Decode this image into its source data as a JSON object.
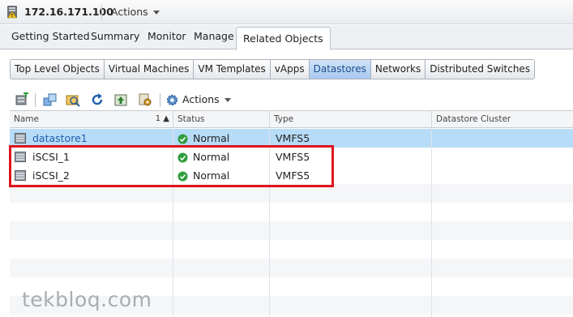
{
  "header": {
    "host": "172.16.171.100",
    "actions_label": "Actions"
  },
  "main_tabs": [
    {
      "label": "Getting Started",
      "active": false
    },
    {
      "label": "Summary",
      "active": false
    },
    {
      "label": "Monitor",
      "active": false
    },
    {
      "label": "Manage",
      "active": false
    },
    {
      "label": "Related Objects",
      "active": true
    }
  ],
  "sub_tabs": [
    {
      "label": "Top Level Objects",
      "active": false
    },
    {
      "label": "Virtual Machines",
      "active": false
    },
    {
      "label": "VM Templates",
      "active": false
    },
    {
      "label": "vApps",
      "active": false
    },
    {
      "label": "Datastores",
      "active": true
    },
    {
      "label": "Networks",
      "active": false
    },
    {
      "label": "Distributed Switches",
      "active": false
    }
  ],
  "toolbar": {
    "icons": [
      "new-datastore-icon",
      "migrate-icon",
      "browse-files-icon",
      "refresh-icon",
      "upload-icon",
      "settings-icon"
    ],
    "actions_label": "Actions"
  },
  "grid": {
    "columns": [
      "Name",
      "Status",
      "Type",
      "Datastore Cluster"
    ],
    "sort_indicator": "1 ▲",
    "rows": [
      {
        "name": "datastore1",
        "status": "Normal",
        "type": "VMFS5",
        "cluster": "",
        "selected": true
      },
      {
        "name": "iSCSI_1",
        "status": "Normal",
        "type": "VMFS5",
        "cluster": "",
        "selected": false
      },
      {
        "name": "iSCSI_2",
        "status": "Normal",
        "type": "VMFS5",
        "cluster": "",
        "selected": false
      }
    ]
  },
  "colors": {
    "accent": "#b7dcf7",
    "highlight": "#e0141d",
    "status_ok": "#2e9e3c"
  },
  "watermark": "tekbloq.com"
}
